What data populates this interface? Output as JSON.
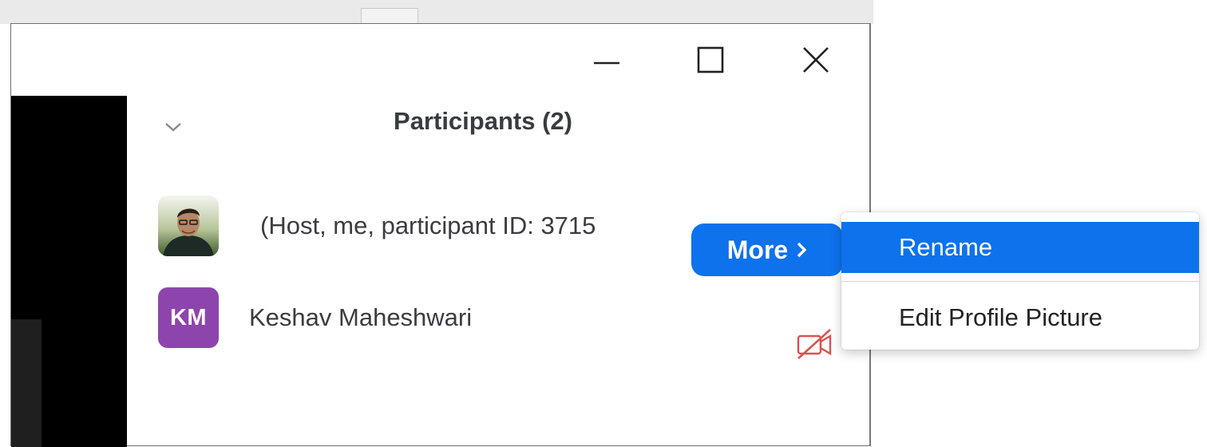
{
  "window": {
    "controls": {
      "minimize_icon": "minimize-icon",
      "maximize_icon": "maximize-icon",
      "close_icon": "close-icon"
    }
  },
  "participants_panel": {
    "title": "Participants (2)",
    "collapse_icon": "chevron-down-icon",
    "participants": [
      {
        "name": "(Host, me, participant ID: 3715",
        "avatar_type": "photo",
        "hover_action": {
          "label": "More",
          "icon": "chevron-right-icon"
        }
      },
      {
        "name": "Keshav Maheshwari",
        "avatar_type": "initials",
        "initials": "KM",
        "avatar_color": "#8e44ad",
        "video_status_icon": "video-off-icon"
      }
    ]
  },
  "context_menu": {
    "items": [
      {
        "label": "Rename",
        "highlighted": true
      },
      {
        "label": "Edit Profile Picture",
        "highlighted": false
      }
    ]
  },
  "colors": {
    "accent": "#0e72ed",
    "title_text": "#383b40",
    "video_off_red": "#d9534f"
  }
}
